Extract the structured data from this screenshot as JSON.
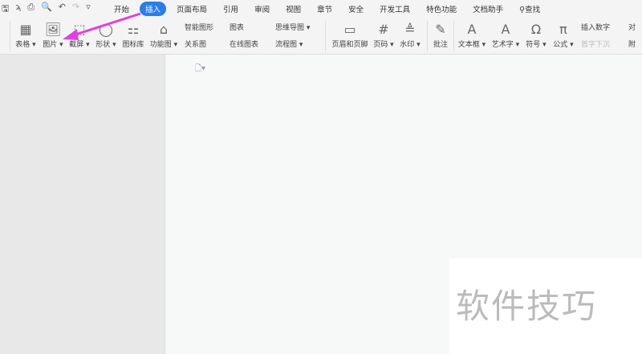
{
  "quick_access": [
    "save-icon",
    "format-painter-icon",
    "print-icon",
    "print-preview-icon",
    "undo-icon",
    "redo-icon",
    "customize-icon"
  ],
  "tabs": [
    "开始",
    "插入",
    "页面布局",
    "引用",
    "审阅",
    "视图",
    "章节",
    "安全",
    "开发工具",
    "特色功能",
    "文档助手"
  ],
  "active_tab": "插入",
  "search": "查找",
  "ribbon": {
    "big": [
      {
        "label": "表格 ▾",
        "icon": "▦"
      },
      {
        "label": "图片 ▾",
        "icon": "🖼"
      },
      {
        "label": "截屏 ▾",
        "icon": "⬚"
      },
      {
        "label": "形状 ▾",
        "icon": "◯"
      },
      {
        "label": "图标库",
        "icon": "⚏"
      },
      {
        "label": "功能图 ▾",
        "icon": "⌂"
      },
      {
        "label": "页眉和页脚",
        "icon": "▭"
      },
      {
        "label": "页码 ▾",
        "icon": "#"
      },
      {
        "label": "水印 ▾",
        "icon": "≜"
      },
      {
        "label": "批注",
        "icon": "✎"
      },
      {
        "label": "文本框 ▾",
        "icon": "A"
      },
      {
        "label": "艺术字 ▾",
        "icon": "A"
      },
      {
        "label": "符号 ▾",
        "icon": "Ω"
      },
      {
        "label": "公式 ▾",
        "icon": "π"
      }
    ],
    "small": [
      "智能图形",
      "关系图",
      "图表",
      "在线图表",
      "思维导图 ▾",
      "流程图 ▾",
      "插入数字",
      "首字下沉",
      "对",
      "附"
    ]
  },
  "watermark": "软件技巧",
  "accent": "#2b7de9",
  "arrow_color": "#e040e0"
}
